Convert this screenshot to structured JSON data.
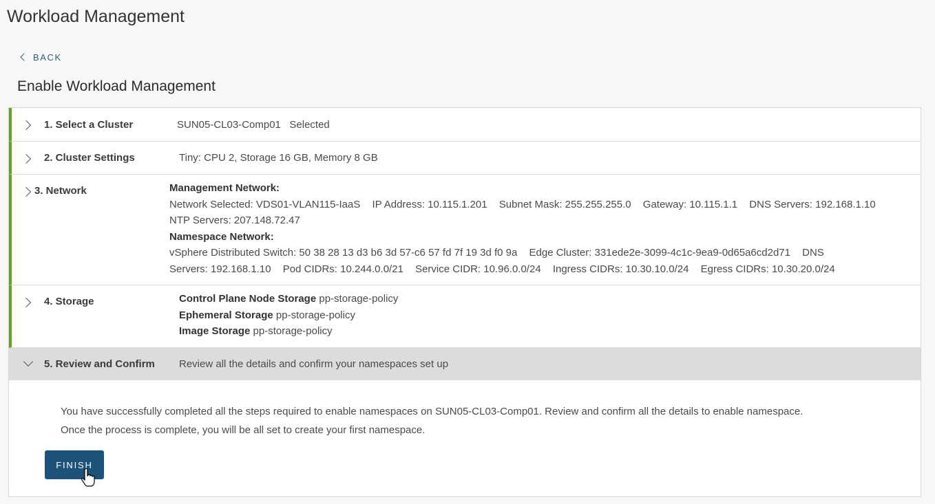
{
  "page": {
    "title": "Workload Management",
    "back_label": "BACK"
  },
  "wizard": {
    "title": "Enable Workload Management",
    "steps": [
      {
        "title": "1. Select a Cluster",
        "summary": "SUN05-CL03-Comp01   Selected"
      },
      {
        "title": "2. Cluster Settings",
        "summary": "Tiny: CPU 2, Storage 16 GB, Memory 8 GB"
      },
      {
        "title": "3. Network",
        "management_heading": "Management Network:",
        "management": {
          "network_selected": "Network Selected: VDS01-VLAN115-IaaS",
          "ip_address": "IP Address: 10.115.1.201",
          "subnet_mask": "Subnet Mask: 255.255.255.0",
          "gateway": "Gateway: 10.115.1.1",
          "dns_servers": "DNS Servers: 192.168.1.10",
          "ntp_servers": "NTP Servers: 207.148.72.47"
        },
        "namespace_heading": "Namespace Network:",
        "namespace": {
          "vds": "vSphere Distributed Switch: 50 38 28 13 d3 b6 3d 57-c6 57 fd 7f 19 3d f0 9a",
          "edge_cluster": "Edge Cluster: 331ede2e-3099-4c1c-9ea9-0d65a6cd2d71",
          "dns_prefix": "DNS",
          "dns_rest": "Servers: 192.168.1.10",
          "pod_cidrs": "Pod CIDRs: 10.244.0.0/21",
          "service_cidr": "Service CIDR: 10.96.0.0/24",
          "ingress_cidrs": "Ingress CIDRs: 10.30.10.0/24",
          "egress_cidrs": "Egress CIDRs: 10.30.20.0/24"
        }
      },
      {
        "title": "4. Storage",
        "control_plane_label": "Control Plane Node Storage",
        "control_plane_value": "pp-storage-policy",
        "ephemeral_label": "Ephemeral Storage",
        "ephemeral_value": "pp-storage-policy",
        "image_label": "Image Storage",
        "image_value": "pp-storage-policy"
      },
      {
        "title": "5. Review and Confirm",
        "summary": "Review all the details and confirm your namespaces set up"
      }
    ],
    "review_text_line1": "You have successfully completed all the steps required to enable namespaces on SUN05-CL03-Comp01. Review and confirm all the details to enable namespace.",
    "review_text_line2": "Once the process is complete, you will be all set to create your first namespace.",
    "finish_label": "FINISH"
  },
  "colors": {
    "done": "#62a420",
    "primary": "#1d5379",
    "active_row": "#dcdcdc"
  },
  "icons": [
    "chevron-left-icon",
    "chevron-right-icon",
    "chevron-down-icon",
    "hand-cursor-icon"
  ]
}
